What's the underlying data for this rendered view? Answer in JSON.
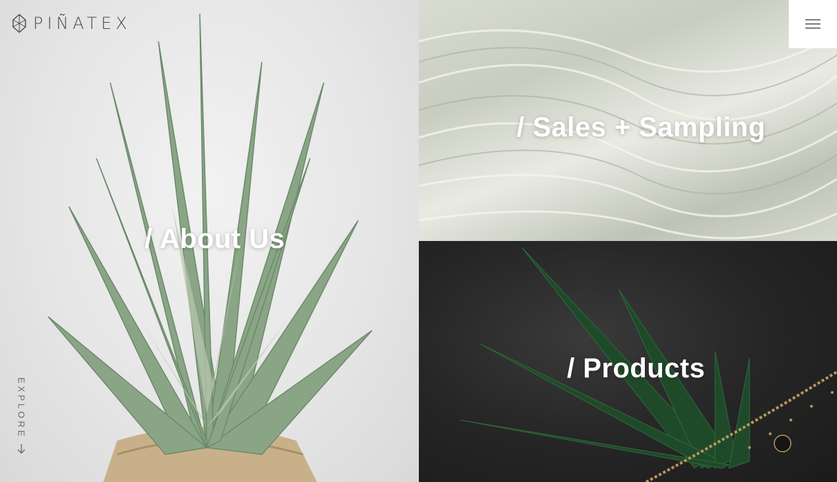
{
  "brand": {
    "name": "PIÑATEX"
  },
  "panels": {
    "about": {
      "title": "/ About Us"
    },
    "sales": {
      "title": "/ Sales + Sampling"
    },
    "products": {
      "title": "/ Products"
    }
  },
  "explore": {
    "label": "EXPLORE"
  },
  "icons": {
    "logo": "pinatex-diamond-icon",
    "menu": "hamburger-menu-icon",
    "explore": "arrow-down-icon"
  },
  "colors": {
    "text_white": "#ffffff",
    "logo_gray": "#4a4a4a",
    "menu_bg": "#ffffff"
  }
}
